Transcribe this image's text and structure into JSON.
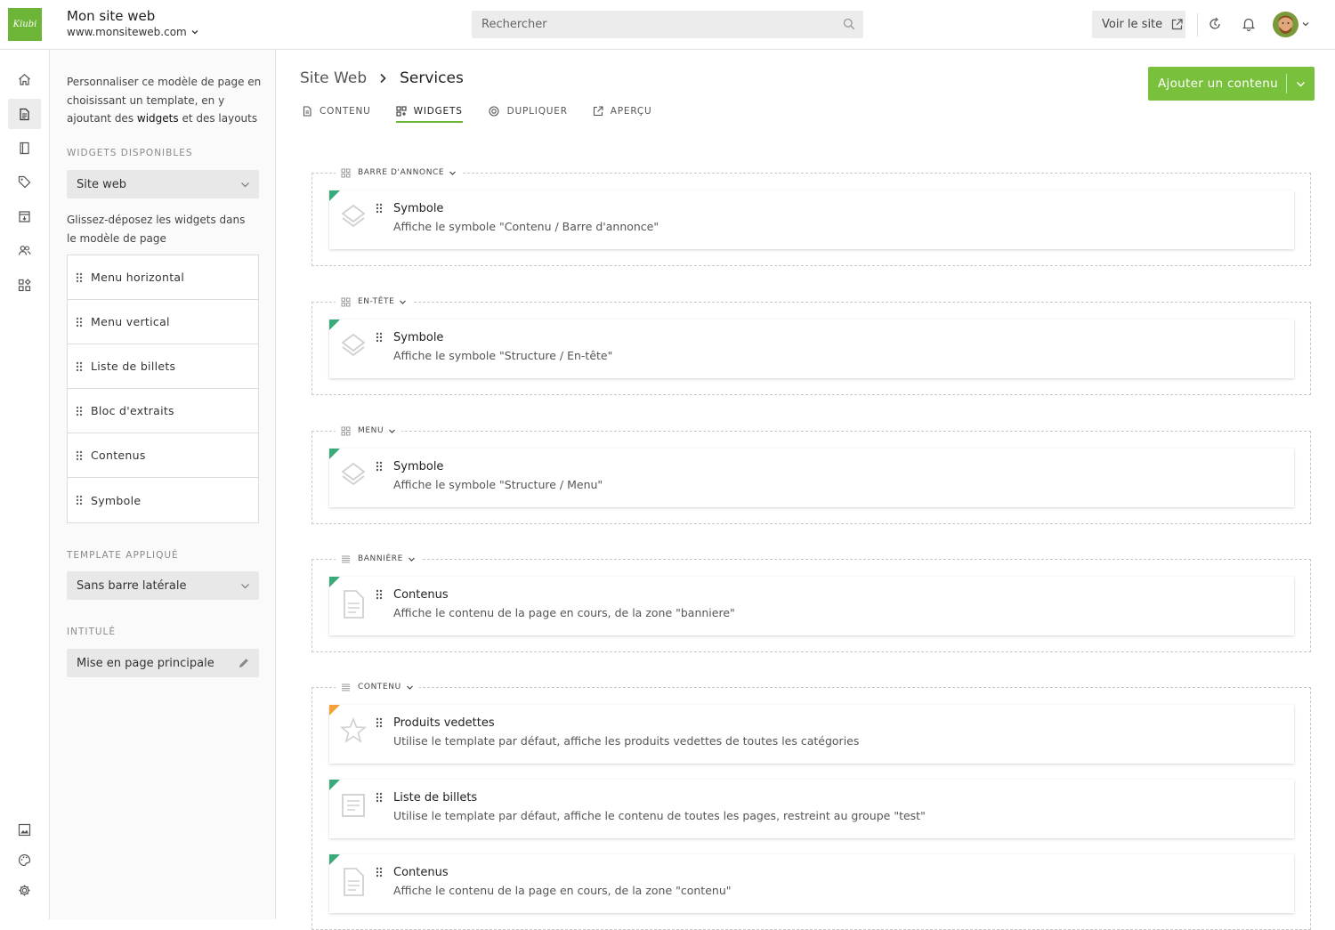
{
  "header": {
    "logo_text": "Kiubi",
    "site_name": "Mon site web",
    "site_url": "www.monsiteweb.com",
    "search_placeholder": "Rechercher",
    "view_site_label": "Voir le site"
  },
  "sidebar_panel": {
    "intro_before": "Personnaliser ce modèle de page en choisissant un template, en y ajoutant des ",
    "intro_bold": "widgets",
    "intro_after": " et des layouts",
    "widgets_label": "WIDGETS DISPONIBLES",
    "widgets_select_value": "Site web",
    "hint": "Glissez-déposez les widgets dans le modèle de page",
    "widgets": [
      "Menu horizontal",
      "Menu vertical",
      "Liste de billets",
      "Bloc d'extraits",
      "Contenus",
      "Symbole"
    ],
    "template_label": "TEMPLATE APPLIQUÉ",
    "template_value": "Sans barre latérale",
    "title_label": "INTITULÉ",
    "title_value": "Mise en page principale"
  },
  "breadcrumb": {
    "parent": "Site Web",
    "current": "Services"
  },
  "tabs": [
    {
      "label": "CONTENU",
      "icon": "document-icon"
    },
    {
      "label": "WIDGETS",
      "icon": "widgets-icon",
      "active": true
    },
    {
      "label": "DUPLIQUER",
      "icon": "duplicate-icon"
    },
    {
      "label": "APERÇU",
      "icon": "external-link-icon"
    }
  ],
  "add_button_label": "Ajouter un contenu",
  "zones": [
    {
      "label": "BARRE D'ANNONCE",
      "icon": "grid-icon",
      "cards": [
        {
          "title": "Symbole",
          "desc": "Affiche le symbole \"Contenu / Barre d'annonce\"",
          "icon": "layers-icon",
          "marker": "green"
        }
      ]
    },
    {
      "label": "EN-TÊTE",
      "icon": "grid-icon",
      "cards": [
        {
          "title": "Symbole",
          "desc": "Affiche le symbole \"Structure / En-tête\"",
          "icon": "layers-icon",
          "marker": "green"
        }
      ]
    },
    {
      "label": "MENU",
      "icon": "grid-icon",
      "cards": [
        {
          "title": "Symbole",
          "desc": "Affiche le symbole \"Structure / Menu\"",
          "icon": "layers-icon",
          "marker": "green"
        }
      ]
    },
    {
      "label": "BANNIÈRE",
      "icon": "lines-icon",
      "cards": [
        {
          "title": "Contenus",
          "desc": "Affiche le contenu de la page en cours, de la zone \"banniere\"",
          "icon": "document-icon",
          "marker": "green"
        }
      ]
    },
    {
      "label": "CONTENU",
      "icon": "lines-icon",
      "cards": [
        {
          "title": "Produits vedettes",
          "desc": "Utilise le template par défaut, affiche les produits vedettes de toutes les catégories",
          "icon": "star-icon",
          "marker": "orange"
        },
        {
          "title": "Liste de billets",
          "desc": "Utilise le template par défaut, affiche le contenu de toutes les pages, restreint au groupe \"test\"",
          "icon": "article-icon",
          "marker": "green"
        },
        {
          "title": "Contenus",
          "desc": "Affiche le contenu de la page en cours, de la zone \"contenu\"",
          "icon": "document-icon",
          "marker": "green"
        }
      ]
    }
  ],
  "colors": {
    "brand_green": "#6cb536",
    "button_green": "#79c13d",
    "marker_green": "#3aaa7b",
    "marker_orange": "#f5a13b"
  }
}
